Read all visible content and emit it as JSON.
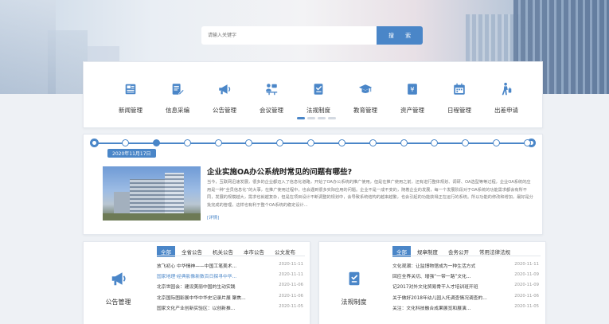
{
  "search": {
    "placeholder": "请输入关键字",
    "button_label": "搜 索"
  },
  "quick_links": [
    {
      "label": "新闻管理",
      "icon": "newspaper-icon"
    },
    {
      "label": "信息采编",
      "icon": "edit-document-icon"
    },
    {
      "label": "公告管理",
      "icon": "megaphone-icon"
    },
    {
      "label": "会议管理",
      "icon": "meeting-icon"
    },
    {
      "label": "法规制度",
      "icon": "regulation-icon"
    },
    {
      "label": "教育管理",
      "icon": "graduation-cap-icon"
    },
    {
      "label": "资产管理",
      "icon": "asset-icon"
    },
    {
      "label": "日程管理",
      "icon": "calendar-icon"
    },
    {
      "label": "出差申请",
      "icon": "traveler-icon"
    }
  ],
  "carousel": {
    "page_count": 4,
    "active_page": 1
  },
  "timeline": {
    "date": "2020年11月17日",
    "node_count": 14,
    "active_node": 1
  },
  "news": {
    "title": "企业实施OA办公系统时常见的问题有哪些?",
    "body": "当今，互联网迅速发展，很多的企业都迈入了信息化道路，开始了OA办公系统的推广使用，但是在推广使用之前，还有进行整体规划、调研、OA选型等等过程，企业OA系统的应用是一种“全员信息化”的大事，在推广使用过程中，也会遇到很多实际应用的问题。企业不是一成不变的，随着企业的发展，每一个发展阶段对于OA系统的功能需求都会有所不同，发展的规模越大，需求也就越复杂，但是在项目设计不断调整的规划中，会导致系统结构的越来越繁，也会引起的功能获得正在运行的系统。所以功能的修改和增加，最好是分批完成的管理，这样也有利于整个OA系统的稳定设计...",
    "more_label": "[详情]"
  },
  "announcements": {
    "side_label": "公告管理",
    "tabs": [
      "全部",
      "全省公告",
      "机关公告",
      "本市公告",
      "公文发布"
    ],
    "active_tab": 0,
    "items": [
      {
        "title": "放飞初心 中华情神——中国工笔美术...",
        "date": "2020-11-11",
        "highlight": false
      },
      {
        "title": "国家地理·经典影像新数百日探寻中华...",
        "date": "2020-11-11",
        "highlight": true
      },
      {
        "title": "北京世园会：建设美丽中国的生动实践",
        "date": "2020-11-06",
        "highlight": false
      },
      {
        "title": "北京国际图影展中华中华史记录片展 聚焦...",
        "date": "2020-11-06",
        "highlight": false
      },
      {
        "title": "国家文化产业创新实验区：以创新推...",
        "date": "2020-11-05",
        "highlight": false
      }
    ]
  },
  "regulations": {
    "side_label": "法规制度",
    "tabs": [
      "全部",
      "规章制度",
      "会务公开",
      "常用法律法规"
    ],
    "active_tab": 0,
    "items": [
      {
        "title": "文化观潮：让监博物馆成为一种生活方式",
        "date": "2020-11-11",
        "highlight": false
      },
      {
        "title": "回应全界关切、增强“一带一路”文化...",
        "date": "2020-11-09",
        "highlight": false
      },
      {
        "title": "记2017对外文化贸易骨干人才培训班开班",
        "date": "2020-11-09",
        "highlight": false
      },
      {
        "title": "关于做好2018年幼儿园入托调查情况调查的...",
        "date": "2020-11-06",
        "highlight": false
      },
      {
        "title": "关注：文化科技融合成果展览和展演...",
        "date": "2020-11-05",
        "highlight": false
      }
    ]
  },
  "colors": {
    "accent": "#4a86c8",
    "background": "#eef1f5"
  }
}
